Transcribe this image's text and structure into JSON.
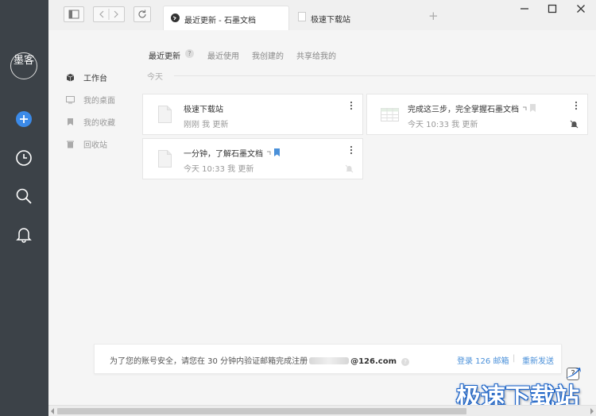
{
  "app": {
    "logo_text": "墨客"
  },
  "browser": {
    "tabs": [
      {
        "label": "最近更新 - 石墨文档",
        "active": true
      },
      {
        "label": "极速下载站",
        "active": false
      }
    ],
    "new_tab_label": "+"
  },
  "sidebar": {
    "items": [
      {
        "label": "工作台",
        "icon": "box-icon",
        "active": true
      },
      {
        "label": "我的桌面",
        "icon": "desktop-icon",
        "active": false
      },
      {
        "label": "我的收藏",
        "icon": "bookmark-icon",
        "active": false
      },
      {
        "label": "回收站",
        "icon": "trash-icon",
        "active": false
      }
    ]
  },
  "content_tabs": {
    "current": "最近更新",
    "help": "?",
    "others": [
      "最近使用",
      "我创建的",
      "共享给我的"
    ]
  },
  "section": {
    "today": "今天"
  },
  "files": [
    {
      "title": "极速下载站",
      "meta": "刚刚 我 更新",
      "icon": "doc-icon"
    },
    {
      "title": "完成这三步，完全掌握石墨文档",
      "meta": "今天 10:33 我 更新",
      "icon": "sheet-icon"
    },
    {
      "title": "一分钟，了解石墨文档",
      "meta": "今天 10:33 我 更新",
      "icon": "doc-icon"
    }
  ],
  "notice": {
    "text": "为了您的账号安全，请您在 30 分钟内验证邮箱完成注册",
    "email_domain": "@126.com",
    "help": "?",
    "login_link": "登录 126 邮箱",
    "separator": "|",
    "resend_link": "重新发送"
  },
  "help_button": "?",
  "watermark": "极速下载站",
  "colors": {
    "rail": "#3c4248",
    "accent": "#4a90d9",
    "watermark_outline": "#1d64c8"
  }
}
